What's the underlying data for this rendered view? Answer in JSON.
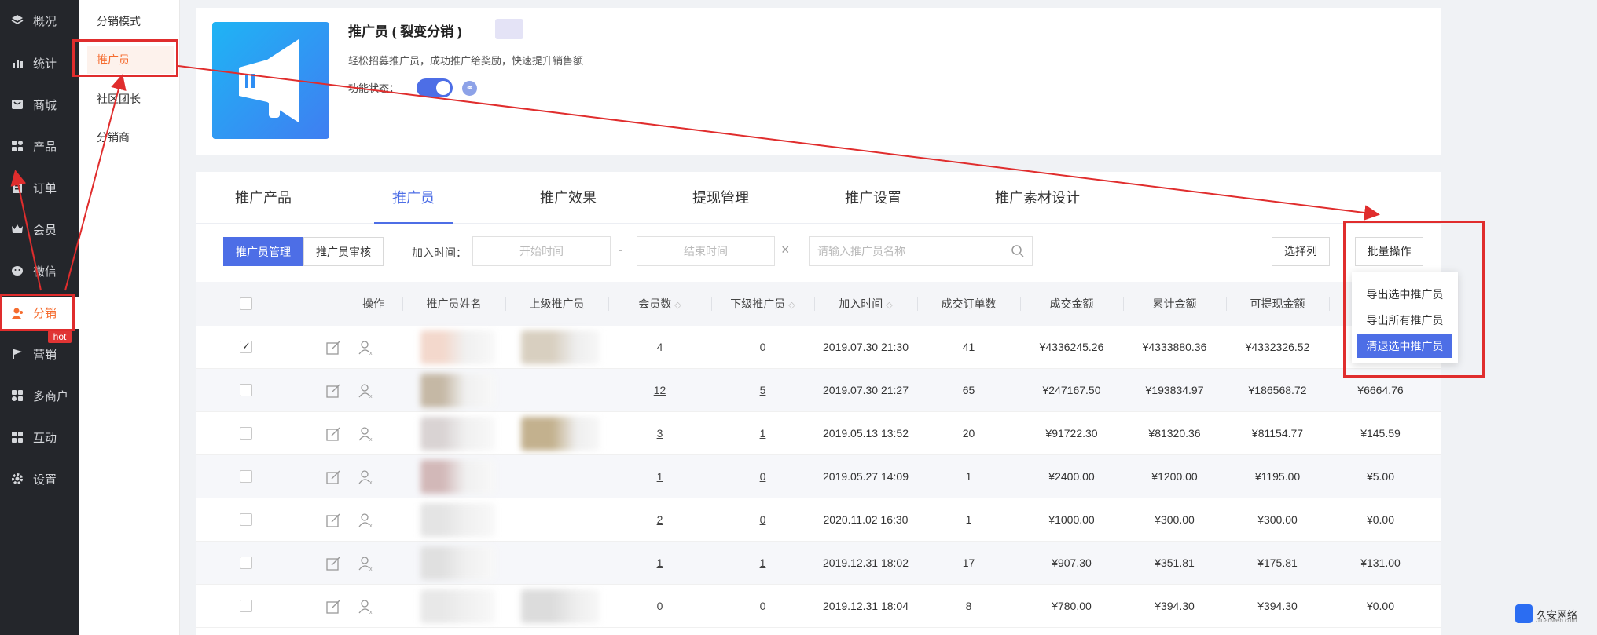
{
  "nav": {
    "items": [
      {
        "label": "概况",
        "icon": "layers-icon"
      },
      {
        "label": "统计",
        "icon": "chart-icon"
      },
      {
        "label": "商城",
        "icon": "shop-icon"
      },
      {
        "label": "产品",
        "icon": "grid-icon"
      },
      {
        "label": "订单",
        "icon": "order-icon"
      },
      {
        "label": "会员",
        "icon": "crown-icon"
      },
      {
        "label": "微信",
        "icon": "wechat-icon"
      },
      {
        "label": "分销",
        "icon": "user-icon"
      },
      {
        "label": "营销",
        "icon": "flag-icon"
      },
      {
        "label": "多商户",
        "icon": "store-icon"
      },
      {
        "label": "互动",
        "icon": "grid-icon"
      },
      {
        "label": "设置",
        "icon": "gear-icon"
      }
    ],
    "hot_badge": "hot"
  },
  "subnav": {
    "items": [
      "分销模式",
      "推广员",
      "社区团长",
      "分销商"
    ]
  },
  "header": {
    "title": "推广员 ( 裂变分销 )",
    "desc": "轻松招募推广员，成功推广给奖励，快速提升销售额",
    "status_label": "功能状态：",
    "status_on": true
  },
  "tabs": [
    "推广产品",
    "推广员",
    "推广效果",
    "提现管理",
    "推广设置",
    "推广素材设计"
  ],
  "filters": {
    "seg_manage": "推广员管理",
    "seg_review": "推广员审核",
    "join_label": "加入时间：",
    "start_placeholder": "开始时间",
    "end_placeholder": "结束时间",
    "date_sep": "-",
    "clear": "×",
    "search_placeholder": "请输入推广员名称",
    "select_columns": "选择列",
    "batch": "批量操作"
  },
  "table": {
    "headers": [
      "操作",
      "推广员姓名",
      "上级推广员",
      "会员数",
      "下级推广员",
      "加入时间",
      "成交订单数",
      "成交金额",
      "累计金额",
      "可提现金额"
    ],
    "rows": [
      {
        "checked": true,
        "members": "4",
        "subs": "0",
        "time": "2019.07.30 21:30",
        "orders": "41",
        "amount": "¥4336245.26",
        "total": "¥4333880.36",
        "withdraw": "¥4332326.52",
        "extra": ""
      },
      {
        "checked": false,
        "members": "12",
        "subs": "5",
        "time": "2019.07.30 21:27",
        "orders": "65",
        "amount": "¥247167.50",
        "total": "¥193834.97",
        "withdraw": "¥186568.72",
        "extra": "¥6664.76"
      },
      {
        "checked": false,
        "members": "3",
        "subs": "1",
        "time": "2019.05.13 13:52",
        "orders": "20",
        "amount": "¥91722.30",
        "total": "¥81320.36",
        "withdraw": "¥81154.77",
        "extra": "¥145.59"
      },
      {
        "checked": false,
        "members": "1",
        "subs": "0",
        "time": "2019.05.27 14:09",
        "orders": "1",
        "amount": "¥2400.00",
        "total": "¥1200.00",
        "withdraw": "¥1195.00",
        "extra": "¥5.00"
      },
      {
        "checked": false,
        "members": "2",
        "subs": "0",
        "time": "2020.11.02 16:30",
        "orders": "1",
        "amount": "¥1000.00",
        "total": "¥300.00",
        "withdraw": "¥300.00",
        "extra": "¥0.00"
      },
      {
        "checked": false,
        "members": "1",
        "subs": "1",
        "time": "2019.12.31 18:02",
        "orders": "17",
        "amount": "¥907.30",
        "total": "¥351.81",
        "withdraw": "¥175.81",
        "extra": "¥131.00"
      },
      {
        "checked": false,
        "members": "0",
        "subs": "0",
        "time": "2019.12.31 18:04",
        "orders": "8",
        "amount": "¥780.00",
        "total": "¥394.30",
        "withdraw": "¥394.30",
        "extra": "¥0.00"
      }
    ]
  },
  "batch_menu": {
    "items": [
      "导出选中推广员",
      "导出所有推广员",
      "清退选中推广员"
    ]
  },
  "watermark": {
    "text": "久安网络",
    "sub": "Jiuanweb.com"
  },
  "colors": {
    "accent": "#4d6ee6",
    "brand_orange": "#f56c2f",
    "highlight_red": "#e02d2d",
    "nav_bg": "#24262b"
  }
}
